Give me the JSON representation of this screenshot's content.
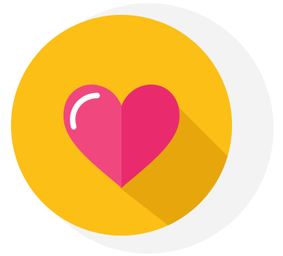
{
  "icon": {
    "name": "heart-icon",
    "colors": {
      "background": "#ffffff",
      "outer_ring": "#f3f3f3",
      "circle": "#fbbf16",
      "long_shadow": "#e7a60c",
      "heart_left": "#f0477f",
      "heart_right": "#e92b6e",
      "highlight": "#ffffff"
    }
  }
}
